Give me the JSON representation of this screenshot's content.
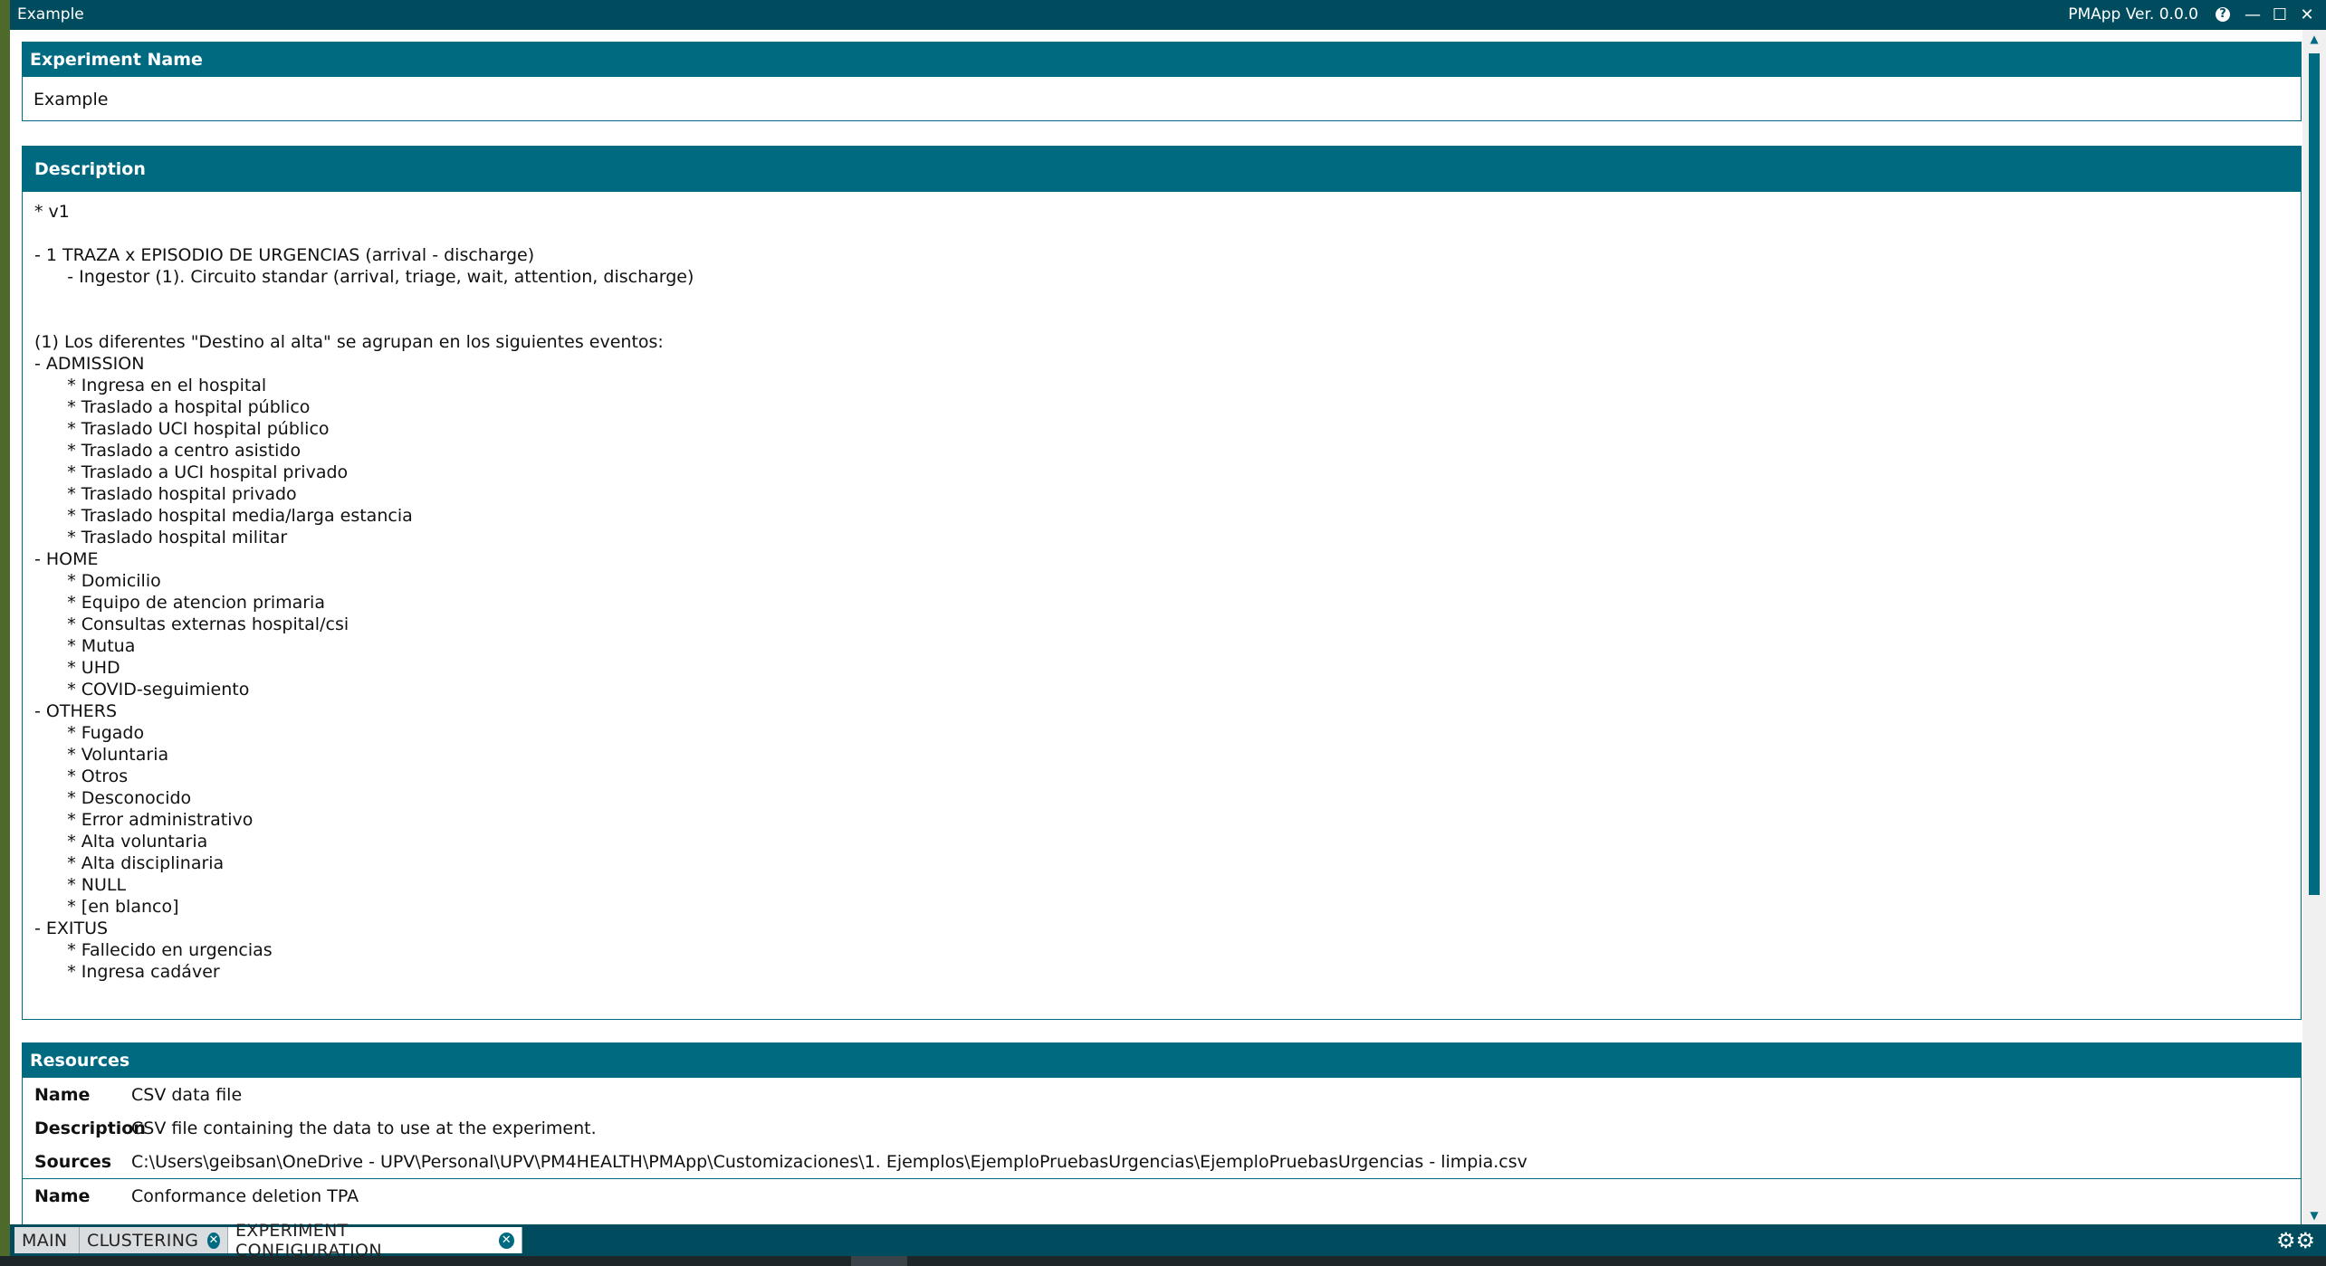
{
  "window": {
    "title": "Example",
    "version": "PMApp Ver. 0.0.0"
  },
  "experiment_name": {
    "header": "Experiment Name",
    "value": "Example"
  },
  "description": {
    "header": "Description",
    "text": "* v1\n\n- 1 TRAZA x EPISODIO DE URGENCIAS (arrival - discharge)\n\t- Ingestor (1). Circuito standar (arrival, triage, wait, attention, discharge)\n\n\n(1) Los diferentes \"Destino al alta\" se agrupan en los siguientes eventos:\n- ADMISSION\n\t* Ingresa en el hospital\n\t* Traslado a hospital público\n\t* Traslado UCI hospital público\n\t* Traslado a centro asistido\n\t* Traslado a UCI hospital privado\n\t* Traslado hospital privado\n\t* Traslado hospital media/larga estancia\n\t* Traslado hospital militar\n- HOME\n\t* Domicilio\n\t* Equipo de atencion primaria\n\t* Consultas externas hospital/csi\n\t* Mutua\n\t* UHD\n\t* COVID-seguimiento\n- OTHERS\n\t* Fugado\n\t* Voluntaria\n\t* Otros\n\t* Desconocido\n\t* Error administrativo\n\t* Alta voluntaria\n\t* Alta disciplinaria\n\t* NULL\n\t* [en blanco]\n- EXITUS\n\t* Fallecido en urgencias\n\t* Ingresa cadáver"
  },
  "resources": {
    "header": "Resources",
    "items": [
      {
        "name_label": "Name",
        "name": "CSV data file",
        "description_label": "Description",
        "description": "CSV file containing the data to use at the experiment.",
        "sources_label": "Sources",
        "sources": "C:\\Users\\geibsan\\OneDrive - UPV\\Personal\\UPV\\PM4HEALTH\\PMApp\\Customizaciones\\1. Ejemplos\\EjemploPruebasUrgencias\\EjemploPruebasUrgencias - limpia.csv"
      },
      {
        "name_label": "Name",
        "name": "Conformance deletion TPA"
      }
    ]
  },
  "tabs": [
    {
      "label": "MAIN",
      "closable": false
    },
    {
      "label": "CLUSTERING",
      "closable": true
    },
    {
      "label": "EXPERIMENT CONFIGURATION",
      "closable": true,
      "active": true
    }
  ],
  "colors": {
    "header": "#006b80",
    "titlebar": "#004c5e"
  }
}
